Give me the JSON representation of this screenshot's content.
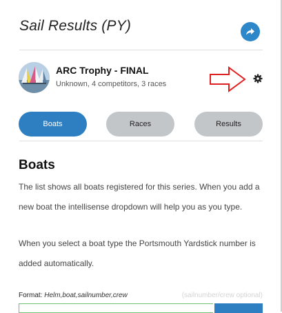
{
  "header": {
    "title": "Sail Results (PY)"
  },
  "series": {
    "title": "ARC Trophy - FINAL",
    "subtitle": "Unknown, 4 competitors, 3 races"
  },
  "tabs": [
    {
      "label": "Boats",
      "active": true
    },
    {
      "label": "Races",
      "active": false
    },
    {
      "label": "Results",
      "active": false
    }
  ],
  "boats_section": {
    "heading": "Boats",
    "paragraph1": "The list shows all boats registered for this series. When you add a new boat the intellisense dropdown will help you as you type.",
    "paragraph2": "When you select a boat type the Portsmouth Yardstick number is added automatically.",
    "format_label": "Format:",
    "format_value": "Helm,boat,sailnumber,crew",
    "format_hint": "(sailnumber/crew optional)"
  },
  "colors": {
    "accent": "#2d7fc2",
    "tab_inactive": "#c3c6c9",
    "annotation_arrow": "#e02020",
    "input_border": "#6fbf73"
  },
  "icons": {
    "share": "share-arrow-icon",
    "settings": "gear-icon",
    "annotation": "right-arrow-outline-icon"
  }
}
